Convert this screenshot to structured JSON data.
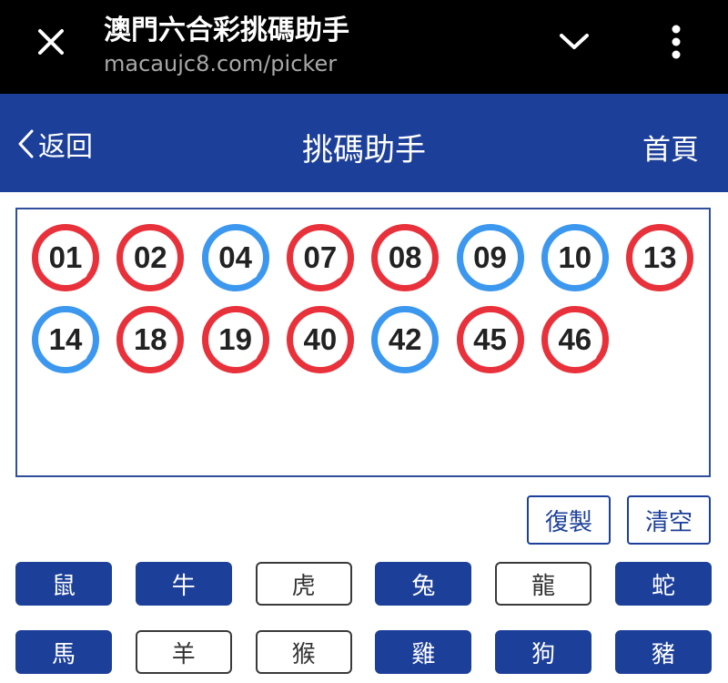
{
  "browser": {
    "title": "澳門六合彩挑碼助手",
    "url": "macaujc8.com/picker"
  },
  "nav": {
    "back_label": "返回",
    "title": "挑碼助手",
    "home_label": "首頁"
  },
  "selected_numbers": [
    {
      "number": "01",
      "color": "red"
    },
    {
      "number": "02",
      "color": "red"
    },
    {
      "number": "04",
      "color": "blue"
    },
    {
      "number": "07",
      "color": "red"
    },
    {
      "number": "08",
      "color": "red"
    },
    {
      "number": "09",
      "color": "blue"
    },
    {
      "number": "10",
      "color": "blue"
    },
    {
      "number": "13",
      "color": "red"
    },
    {
      "number": "14",
      "color": "blue"
    },
    {
      "number": "18",
      "color": "red"
    },
    {
      "number": "19",
      "color": "red"
    },
    {
      "number": "40",
      "color": "red"
    },
    {
      "number": "42",
      "color": "blue"
    },
    {
      "number": "45",
      "color": "red"
    },
    {
      "number": "46",
      "color": "red"
    }
  ],
  "actions": {
    "copy_label": "復製",
    "clear_label": "清空"
  },
  "zodiac": [
    {
      "label": "鼠",
      "selected": true
    },
    {
      "label": "牛",
      "selected": true
    },
    {
      "label": "虎",
      "selected": false
    },
    {
      "label": "兔",
      "selected": true
    },
    {
      "label": "龍",
      "selected": false
    },
    {
      "label": "蛇",
      "selected": true
    },
    {
      "label": "馬",
      "selected": true
    },
    {
      "label": "羊",
      "selected": false
    },
    {
      "label": "猴",
      "selected": false
    },
    {
      "label": "雞",
      "selected": true
    },
    {
      "label": "狗",
      "selected": true
    },
    {
      "label": "豬",
      "selected": true
    }
  ],
  "colors": {
    "primary": "#1c3f99",
    "ball_red": "#e8313a",
    "ball_blue": "#3c97ef"
  }
}
